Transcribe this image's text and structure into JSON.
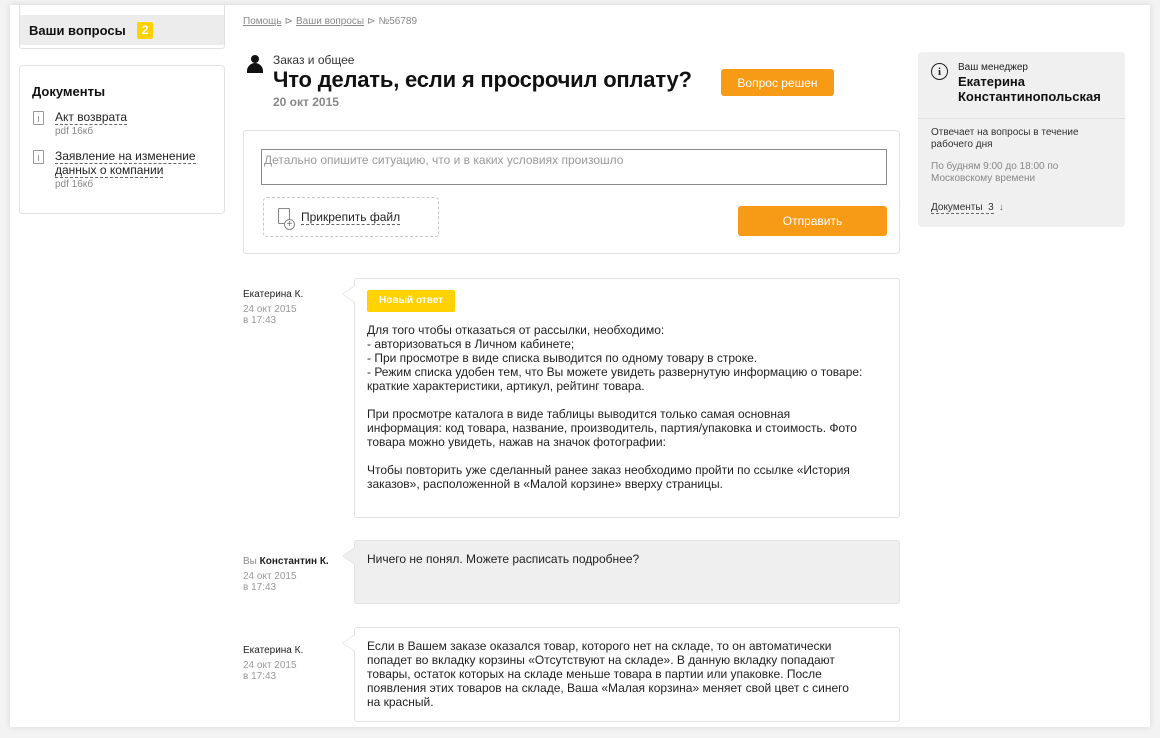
{
  "sidebar": {
    "nav": {
      "label": "Ваши вопросы",
      "count": "2"
    },
    "documents": {
      "title": "Документы",
      "items": [
        {
          "name": "Акт возврата",
          "meta": "pdf  16кб"
        },
        {
          "name": "Заявление на изменение данных о компании",
          "meta": "pdf  16кб"
        }
      ]
    }
  },
  "breadcrumb": {
    "items": [
      "Помощь",
      "Ваши вопросы"
    ],
    "current": "№56789",
    "separator": "⊳"
  },
  "question": {
    "category": "Заказ и общее",
    "title": "Что делать, если я просрочил оплату?",
    "solved_label": "Вопрос решен",
    "date": "20 окт 2015"
  },
  "reply": {
    "placeholder": "Детально опишите ситуацию, что и в каких условиях произошло",
    "attach_label": "Прикрепить файл",
    "send_label": "Отправить"
  },
  "messages": [
    {
      "prefix": "",
      "author": "Екатерина К.",
      "date": "24 окт 2015",
      "time": "в 17:43",
      "badge": "Новый ответ",
      "lines1": [
        "Для того чтобы отказаться от рассылки, необходимо:",
        "- авторизоваться в Личном кабинете;",
        "- При просмотре в виде списка выводится по одному товару в строке.",
        "- Режим списка удобен тем, что Вы можете увидеть развернутую информацию о товаре:",
        "краткие характеристики, артикул, рейтинг товара."
      ],
      "lines2": [
        "При просмотре каталога в виде таблицы выводится только самая основная",
        "информация: код товара, название, производитель, партия/упаковка и стоимость. Фото",
        "товара можно увидеть, нажав на значок фотографии:"
      ],
      "lines3": [
        "Чтобы повторить уже сделанный ранее заказ необходимо пройти по ссылке «История",
        "заказов», расположенной в «Малой корзине» вверху страницы."
      ]
    },
    {
      "prefix": "Вы",
      "author": "Константин К.",
      "date": "24 окт 2015",
      "time": "в 17:43",
      "text": "Ничего не понял. Можете расписать подробнее?"
    },
    {
      "prefix": "",
      "author": "Екатерина К.",
      "date": "24 окт 2015",
      "time": "в 17:43",
      "lines": [
        "Если в Вашем заказе оказался товар, которого нет на складе, то он автоматически",
        "попадет во вкладку корзины «Отсутствуют на складе». В данную вкладку попадают",
        "товары, остаток которых на складе меньше товара в партии или упаковке. После",
        "появления этих товаров на складе, Ваша «Малая корзина» меняет свой цвет с синего",
        "на красный."
      ]
    }
  ],
  "manager": {
    "label": "Ваш менеджер",
    "name": "Екатерина Константинопольская",
    "responds": "Отвечает на вопросы в течение рабочего дня",
    "hours": "По будням 9:00 до 18:00 по Московскому времени",
    "docs_label": "Документы",
    "docs_count": "3",
    "docs_arrow": "↓"
  },
  "colors": {
    "accent": "#f79a16",
    "badge": "#ffd200",
    "panel": "#f0f0f0"
  }
}
